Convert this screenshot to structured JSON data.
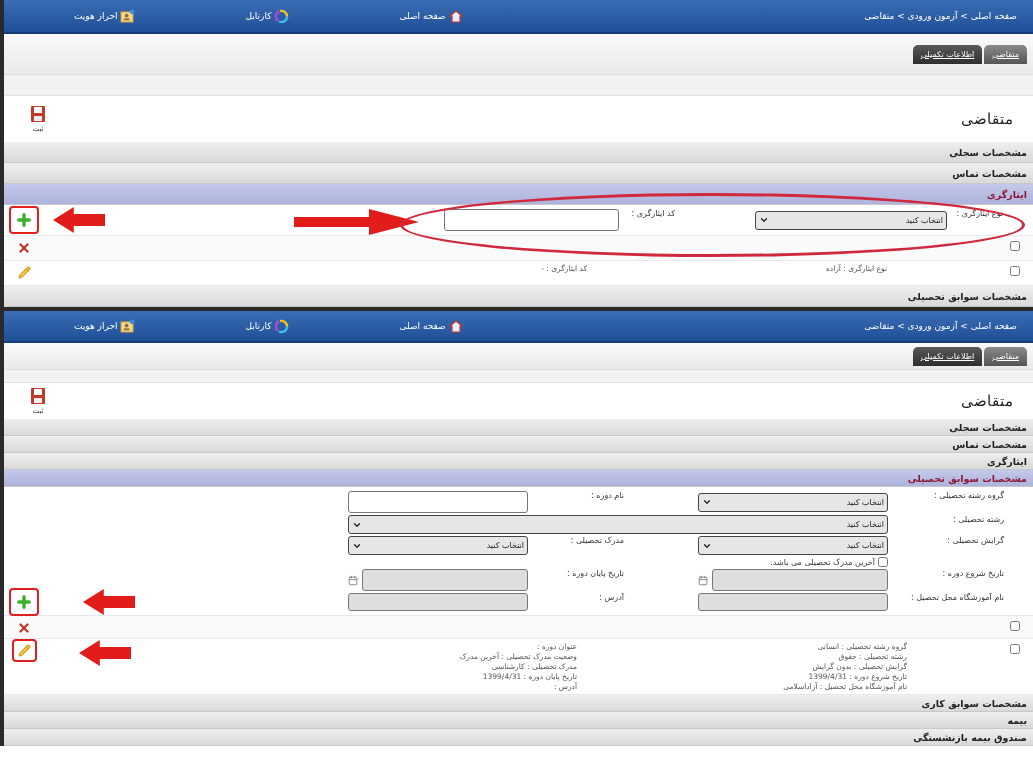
{
  "screens": [
    {
      "breadcrumb": "صفحه اصلی > آزمون ورودی > متقاضی",
      "nav": [
        {
          "label": "صفحه اصلی"
        },
        {
          "label": "کارتابل"
        },
        {
          "label": "احراز هویت"
        }
      ],
      "tabs": [
        {
          "label": "متقاضی",
          "selected": true
        },
        {
          "label": "اطلاعات تکمیلی",
          "selected": false
        }
      ],
      "title": "متقاضی",
      "save_button": "ثبت",
      "sections": [
        {
          "title": "مشخصات سجلی",
          "expanded": false
        },
        {
          "title": "مشخصات تماس",
          "expanded": false
        },
        {
          "title": "ایثارگری",
          "expanded": true,
          "form": [
            [
              {
                "kind": "select",
                "label": "نوع ایثارگری :",
                "value": "انتخاب کنید"
              },
              {
                "kind": "input",
                "label": "کد ایثارگری :",
                "disabled": false
              }
            ]
          ],
          "records": [
            {
              "checked": false
            },
            {
              "checked": false,
              "columns": [
                [
                  "نوع ایثارگری : آزاده"
                ],
                [
                  "کد ایثارگری : -"
                ]
              ]
            }
          ]
        },
        {
          "title": "مشخصات سوابق تحصیلی",
          "expanded": false
        }
      ]
    },
    {
      "breadcrumb": "صفحه اصلی > آزمون ورودی > متقاضی",
      "nav": [
        {
          "label": "صفحه اصلی"
        },
        {
          "label": "کارتابل"
        },
        {
          "label": "احراز هویت"
        }
      ],
      "tabs": [
        {
          "label": "متقاضی",
          "selected": true
        },
        {
          "label": "اطلاعات تکمیلی",
          "selected": false
        }
      ],
      "title": "متقاضی",
      "save_button": "ثبت",
      "sections": [
        {
          "title": "مشخصات سجلی",
          "expanded": false
        },
        {
          "title": "مشخصات تماس",
          "expanded": false
        },
        {
          "title": "ایثارگری",
          "expanded": false
        },
        {
          "title": "مشخصات سوابق تحصیلی",
          "expanded": true,
          "form": [
            [
              {
                "kind": "select",
                "label": "گروه رشته تحصیلی :",
                "value": "انتخاب کنید"
              },
              {
                "kind": "input",
                "label": "نام دوره :",
                "disabled": false
              }
            ],
            [
              {
                "kind": "select",
                "label": "رشته تحصیلی :",
                "value": "انتخاب کنید",
                "wide": true
              }
            ],
            [
              {
                "kind": "select",
                "label": "گرایش تحصیلی :",
                "value": "انتخاب کنید"
              },
              {
                "kind": "select",
                "label": "مدرک تحصیلی :",
                "value": "انتخاب کنید"
              }
            ],
            [
              {
                "kind": "checkbox",
                "label": "آخرین مدرک تحصیلی می باشد.",
                "checked": false
              }
            ],
            [
              {
                "kind": "date",
                "label": "تاریخ شروع دوره :",
                "disabled": true
              },
              {
                "kind": "date",
                "label": "تاریخ پایان دوره :",
                "disabled": true
              }
            ],
            [
              {
                "kind": "input",
                "label": "نام آموزشگاه محل تحصیل :",
                "disabled": true
              },
              {
                "kind": "input",
                "label": "آدرس :",
                "disabled": true
              }
            ]
          ],
          "records": [
            {
              "checked": false
            },
            {
              "checked": false,
              "columns": [
                [
                  "گروه رشته تحصیلی : انسانی",
                  "رشته تحصیلی : حقوق",
                  "گرایش تحصیلی : بدون گرایش",
                  "تاریخ شروع دوره : 1399/4/31",
                  "نام آموزشگاه محل تحصیل : آزاداسلامی"
                ],
                [
                  "عنوان دوره :",
                  "وضعیت مدرک تحصیلی : آخرین مدرک",
                  "مدرک تحصیلی : کارشناسی",
                  "تاریخ پایان دوره : 1399/4/31",
                  "آدرس :"
                ]
              ]
            }
          ]
        },
        {
          "title": "مشخصات سوابق کاری",
          "expanded": false
        },
        {
          "title": "بیمه",
          "expanded": false
        },
        {
          "title": "صندوق بیمه بازنشستگی",
          "expanded": false
        }
      ]
    }
  ]
}
